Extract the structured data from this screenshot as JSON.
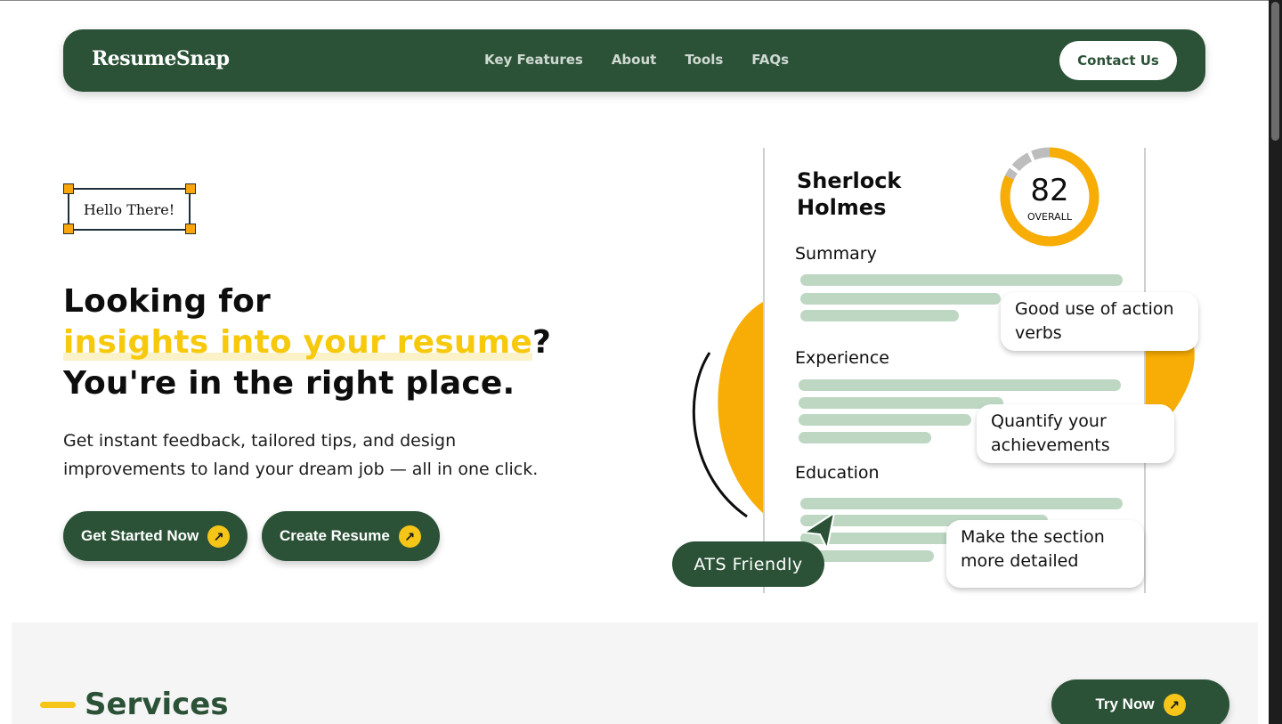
{
  "colors": {
    "brand_green": "#2b5237",
    "accent_yellow": "#f5c518",
    "orange": "#f7ad05",
    "bar_green": "#bdd7c3"
  },
  "nav": {
    "logo": "ResumeSnap",
    "links": [
      "Key Features",
      "About",
      "Tools",
      "FAQs"
    ],
    "contact_label": "Contact Us"
  },
  "hero": {
    "badge": "Hello There!",
    "headline_line1": "Looking for",
    "headline_highlight": "insights into your resume",
    "headline_q": "?",
    "headline_line3": "You're in the right place.",
    "subtext": "Get instant feedback, tailored tips, and design improvements to land your dream job — all in one click.",
    "btn_start": "Get Started Now",
    "btn_create": "Create Resume",
    "arrow_icon": "arrow-up-right-icon"
  },
  "illustration": {
    "name_line1": "Sherlock",
    "name_line2": "Holmes",
    "score": "82",
    "score_label": "OVERALL",
    "score_fraction": 0.82,
    "sections": [
      "Summary",
      "Experience",
      "Education"
    ],
    "tips": [
      "Good use of action verbs",
      "Quantify your achievements",
      "Make the section more detailed"
    ],
    "ats_label": "ATS Friendly"
  },
  "services": {
    "title": "Services",
    "try_label": "Try Now"
  }
}
